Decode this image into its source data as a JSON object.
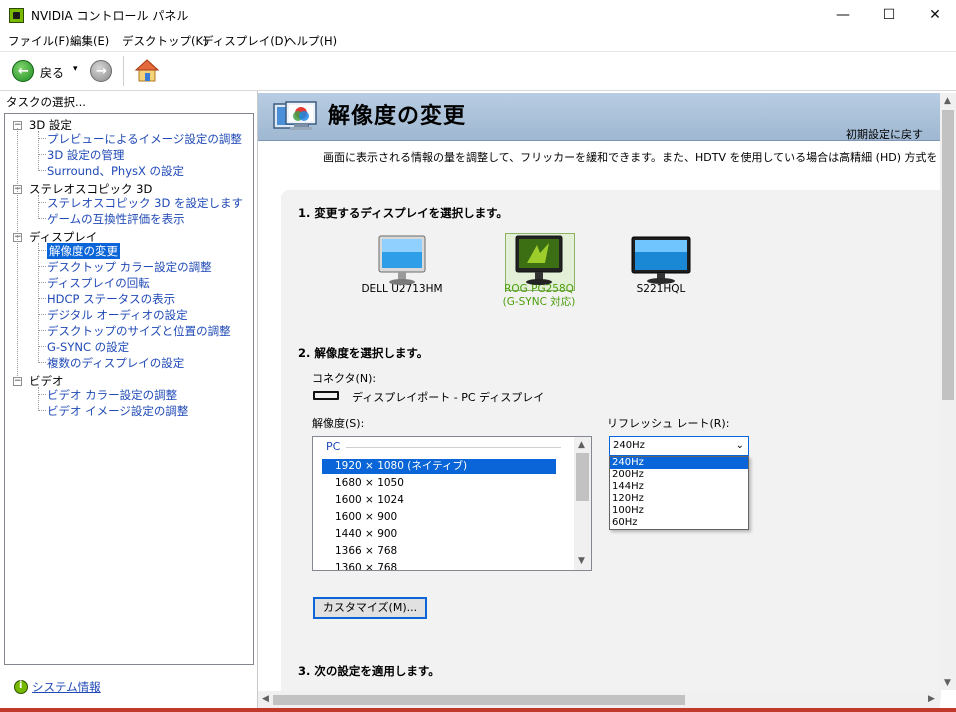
{
  "window": {
    "title": "NVIDIA コントロール パネル",
    "controls": {
      "minimize": "—",
      "maximize": "☐",
      "close": "✕"
    }
  },
  "menu": [
    "ファイル(F)",
    "編集(E)",
    "デスクトップ(K)",
    "ディスプレイ(D)",
    "ヘルプ(H)"
  ],
  "toolbar": {
    "back_label": "戻る",
    "dropdown": "▾",
    "back_icon": "←",
    "forward_icon": "→"
  },
  "sidebar": {
    "label": "タスクの選択...",
    "toggle": "−",
    "categories": [
      {
        "name": "3D 設定",
        "items": [
          "プレビューによるイメージ設定の調整",
          "3D 設定の管理",
          "Surround、PhysX の設定"
        ]
      },
      {
        "name": "ステレオスコピック 3D",
        "items": [
          "ステレオスコピック 3D を設定します",
          "ゲームの互換性評価を表示"
        ]
      },
      {
        "name": "ディスプレイ",
        "items": [
          "解像度の変更",
          "デスクトップ カラー設定の調整",
          "ディスプレイの回転",
          "HDCP ステータスの表示",
          "デジタル オーディオの設定",
          "デスクトップのサイズと位置の調整",
          "G-SYNC の設定",
          "複数のディスプレイの設定"
        ]
      },
      {
        "name": "ビデオ",
        "items": [
          "ビデオ カラー設定の調整",
          "ビデオ イメージ設定の調整"
        ]
      }
    ],
    "selected_item": "解像度の変更",
    "system_info": "システム情報"
  },
  "page": {
    "title": "解像度の変更",
    "restore_defaults": "初期設定に戻す",
    "description": "画面に表示される情報の量を調整して、フリッカーを緩和できます。また、HDTV を使用している場合は高精細 (HD) 方式を選択し、"
  },
  "section1": {
    "title": "1. 変更するディスプレイを選択します。",
    "displays": [
      {
        "name": "DELL U2713HM"
      },
      {
        "name": "ROG PG258Q\n(G-SYNC 対応)",
        "selected": true
      },
      {
        "name": "S221HQL"
      }
    ]
  },
  "section2": {
    "title": "2. 解像度を選択します。",
    "connector_label": "コネクタ(N):",
    "connector_value": "ディスプレイポート - PC ディスプレイ",
    "resolution_label": "解像度(S):",
    "resolution_group": "PC",
    "resolutions": [
      "1920 × 1080 (ネイティブ)",
      "1680 × 1050",
      "1600 × 1024",
      "1600 × 900",
      "1440 × 900",
      "1366 × 768",
      "1360 × 768"
    ],
    "selected_resolution": "1920 × 1080 (ネイティブ)",
    "refresh_label": "リフレッシュ レート(R):",
    "refresh_current": "240Hz",
    "refresh_options": [
      "240Hz",
      "200Hz",
      "144Hz",
      "120Hz",
      "100Hz",
      "60Hz"
    ],
    "customize_button": "カスタマイズ(M)..."
  },
  "section3": {
    "title": "3. 次の設定を適用します。"
  },
  "colors": {
    "accent": "#0a65d8",
    "nvidia_green": "#76b900",
    "link": "#1f49b6",
    "header_band": "#9fb7d1"
  }
}
